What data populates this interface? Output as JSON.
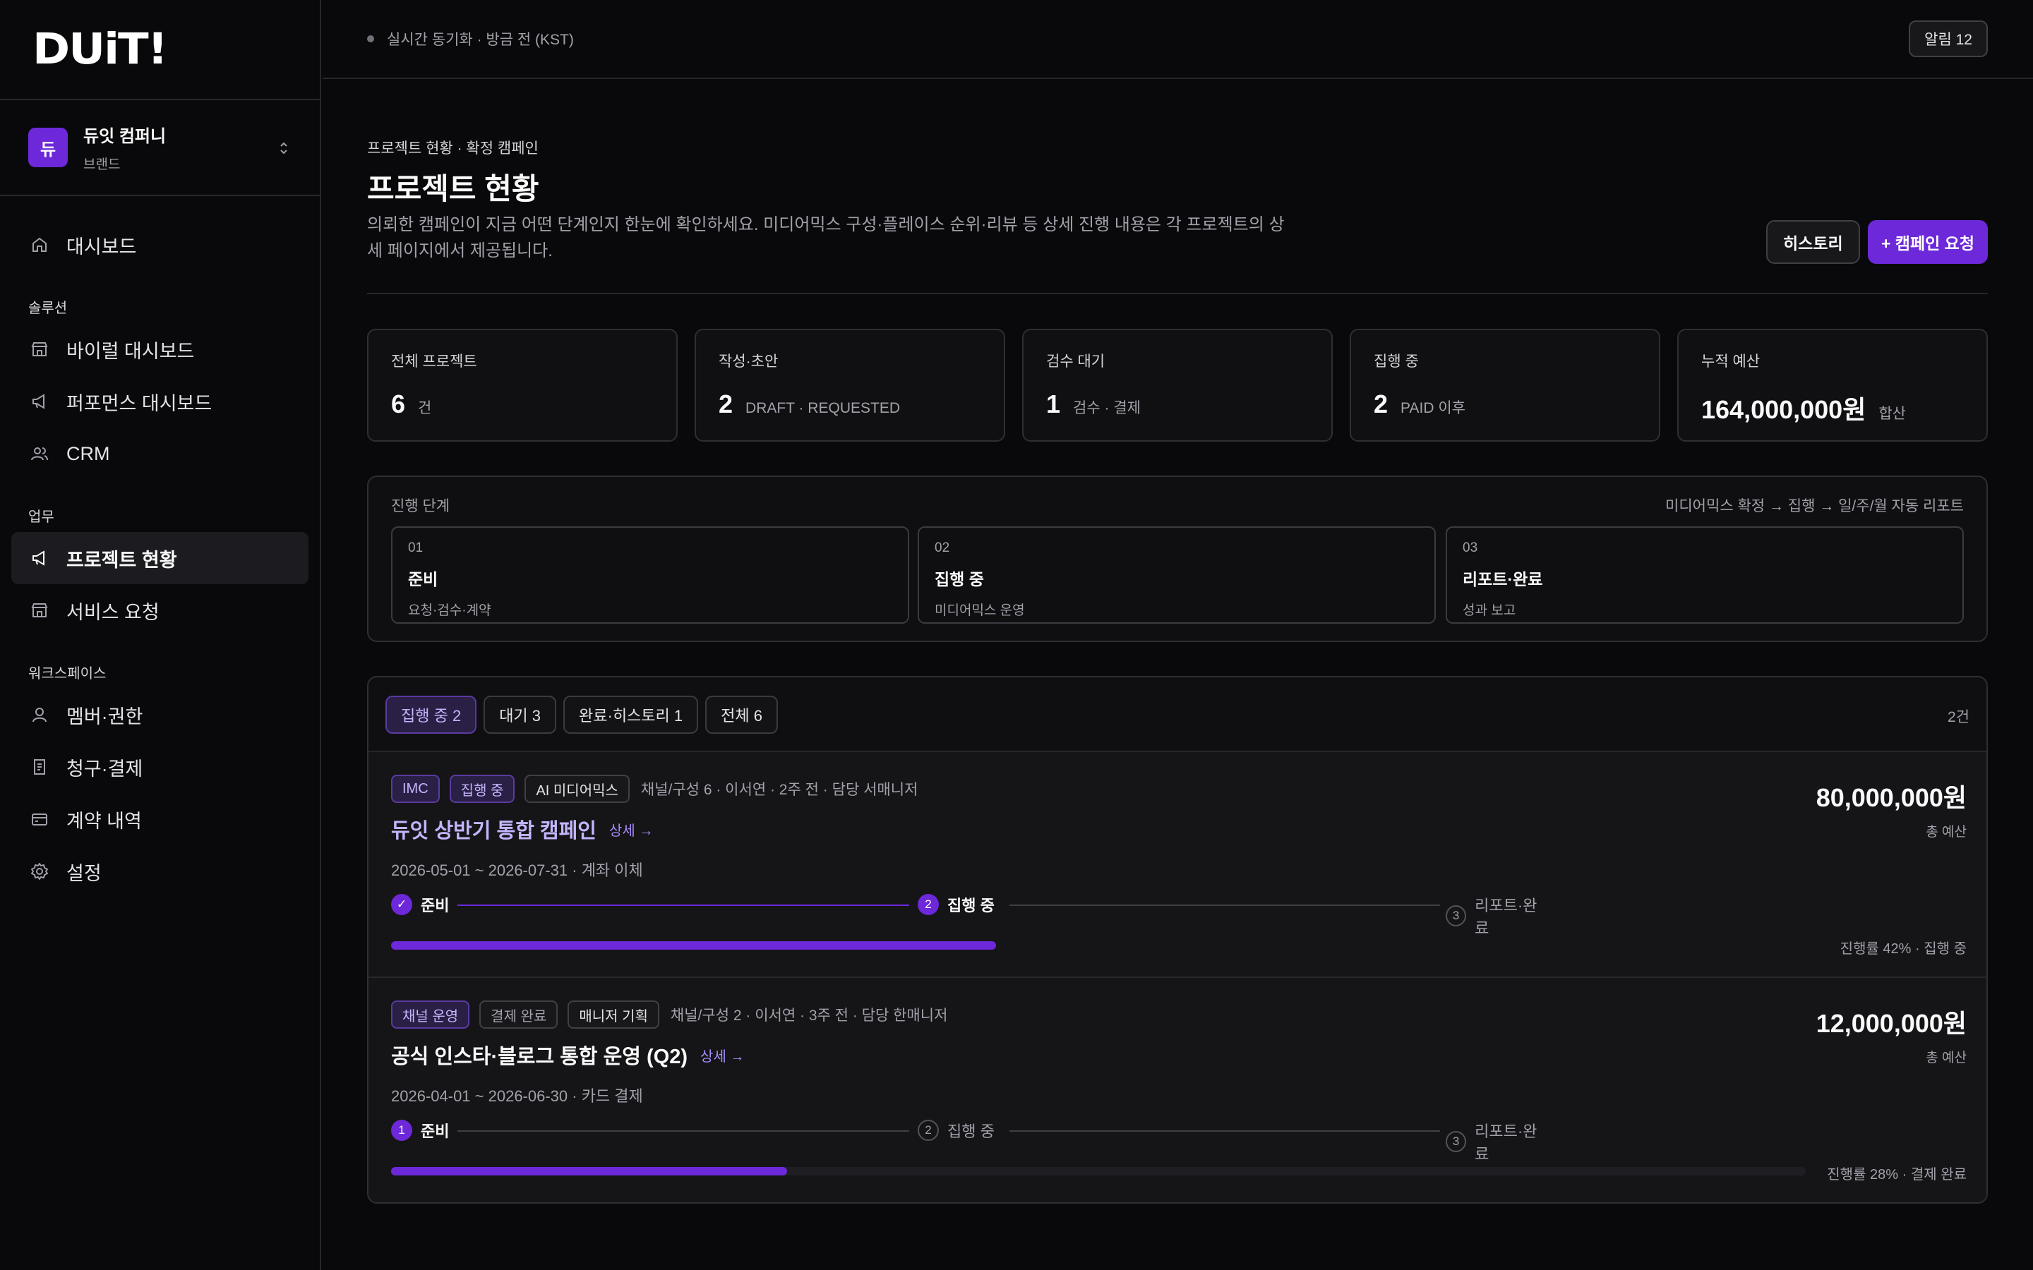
{
  "brand": {
    "logo": "DUiT!"
  },
  "org": {
    "avatar": "듀",
    "name": "듀잇 컴퍼니",
    "role": "브랜드"
  },
  "nav": {
    "dashboard": "대시보드",
    "section_solution": "솔루션",
    "viral": "바이럴 대시보드",
    "performance": "퍼포먼스 대시보드",
    "crm": "CRM",
    "section_work": "업무",
    "project_status": "프로젝트 현황",
    "service_request": "서비스 요청",
    "section_workspace": "워크스페이스",
    "members": "멤버·권한",
    "billing": "청구·결제",
    "contracts": "계약 내역",
    "settings": "설정"
  },
  "topbar": {
    "sync": "실시간 동기화 · 방금 전 (KST)",
    "alarm": "알림 12"
  },
  "page": {
    "breadcrumb": "프로젝트 현황 · 확정 캠페인",
    "title": "프로젝트 현황",
    "description": "의뢰한 캠페인이 지금 어떤 단계인지 한눈에 확인하세요. 미디어믹스 구성·플레이스 순위·리뷰 등 상세 진행 내용은 각 프로젝트의 상세 페이지에서 제공됩니다.",
    "history_button": "히스토리",
    "request_button": "+ 캠페인 요청"
  },
  "stats": [
    {
      "label": "전체 프로젝트",
      "value": "6",
      "sub": "건"
    },
    {
      "label": "작성·초안",
      "value": "2",
      "sub": "DRAFT · REQUESTED"
    },
    {
      "label": "검수 대기",
      "value": "1",
      "sub": "검수 · 결제"
    },
    {
      "label": "집행 중",
      "value": "2",
      "sub": "PAID 이후"
    },
    {
      "label": "누적 예산",
      "value": "164,000,000원",
      "sub": "합산"
    }
  ],
  "stages": {
    "title": "진행 단계",
    "flow": "미디어믹스 확정 → 집행 → 일/주/월 자동 리포트",
    "items": [
      {
        "no": "01",
        "name": "준비",
        "desc": "요청·검수·계약"
      },
      {
        "no": "02",
        "name": "집행 중",
        "desc": "미디어믹스 운영"
      },
      {
        "no": "03",
        "name": "리포트·완료",
        "desc": "성과 보고"
      }
    ]
  },
  "filters": {
    "items": [
      "집행 중 2",
      "대기 3",
      "완료·히스토리 1",
      "전체 6"
    ],
    "count": "2건"
  },
  "projects": [
    {
      "tags": [
        "IMC",
        "집행 중",
        "AI 미디어믹스"
      ],
      "meta": "채널/구성 6 · 이서연 · 2주 전 · 담당 서매니저",
      "title": "듀잇 상반기 통합 캠페인",
      "detail": "상세 →",
      "dates": "2026-05-01 ~ 2026-07-31  ·  계좌 이체",
      "budget": "80,000,000원",
      "budget_label": "총 예산",
      "steps": [
        {
          "mark": "✓",
          "label": "준비"
        },
        {
          "mark": "2",
          "label": "집행 중"
        },
        {
          "mark": "3",
          "label": "리포트·완료"
        }
      ],
      "progress": 42,
      "progress_text": "진행률 42% · 집행 중",
      "title_color": "#c4b5fd"
    },
    {
      "tags": [
        "채널 운영",
        "결제 완료",
        "매니저 기획"
      ],
      "meta": "채널/구성 2 · 이서연 · 3주 전 · 담당 한매니저",
      "title": "공식 인스타·블로그 통합 운영 (Q2)",
      "detail": "상세 →",
      "dates": "2026-04-01 ~ 2026-06-30  ·  카드 결제",
      "budget": "12,000,000원",
      "budget_label": "총 예산",
      "steps": [
        {
          "mark": "1",
          "label": "준비"
        },
        {
          "mark": "2",
          "label": "집행 중"
        },
        {
          "mark": "3",
          "label": "리포트·완료"
        }
      ],
      "progress": 28,
      "progress_text": "진행률 28% · 결제 완료",
      "title_color": "#fafafa"
    }
  ]
}
